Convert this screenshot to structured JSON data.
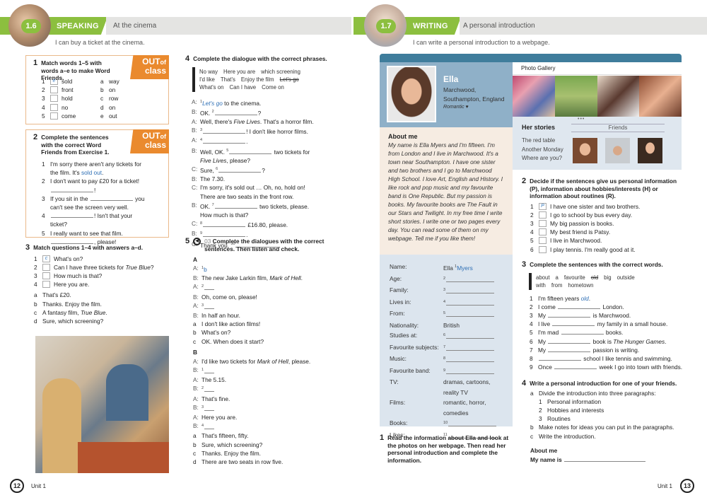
{
  "left": {
    "header": {
      "num": "1.6",
      "kind": "SPEAKING",
      "title": "At the cinema",
      "subtitle": "I can buy a ticket at the cinema."
    },
    "out_of_class": {
      "big": "OUT",
      "small": "of",
      "line2": "class"
    },
    "ex1": {
      "num": "1",
      "title": "Match words 1–5 with words a–e to make Word Friends.",
      "items": [
        {
          "n": "1",
          "box": "e",
          "s": [
            "sold"
          ]
        },
        {
          "n": "2",
          "box": "",
          "s": [
            "front"
          ]
        },
        {
          "n": "3",
          "box": "",
          "s": [
            "hold"
          ]
        },
        {
          "n": "4",
          "box": "",
          "s": [
            "no"
          ]
        },
        {
          "n": "5",
          "box": "",
          "s": [
            "come"
          ]
        }
      ],
      "matches": [
        {
          "n": "a",
          "s": [
            "way"
          ]
        },
        {
          "n": "b",
          "s": [
            "on"
          ]
        },
        {
          "n": "c",
          "s": [
            "row"
          ]
        },
        {
          "n": "d",
          "s": [
            "on"
          ]
        },
        {
          "n": "e",
          "s": [
            "out"
          ]
        }
      ]
    },
    "ex2": {
      "num": "2",
      "title": "Complete the sentences with the correct Word Friends from Exercise 1.",
      "items": [
        {
          "n": "1",
          "s": [
            "I'm sorry there aren't any tickets for the film. It's ",
            {
              "a": "sold out"
            },
            "."
          ]
        },
        {
          "n": "2",
          "s": [
            "I don't want to pay £20 for a ticket! ",
            {
              "br": 1
            },
            {
              "blank": 1
            },
            "!"
          ]
        },
        {
          "n": "3",
          "s": [
            "If you sit in the ",
            {
              "blank": 1
            },
            " you can't see the screen very well."
          ]
        },
        {
          "n": "4",
          "s": [
            {
              "blank": 1
            },
            "! Isn't that your ticket?"
          ]
        },
        {
          "n": "5",
          "s": [
            "I really want to see that film. ",
            {
              "br": 1
            },
            {
              "blank": 1
            },
            ", please!"
          ]
        }
      ]
    },
    "ex3": {
      "num": "3",
      "title": "Match questions 1–4 with answers a–d.",
      "items": [
        {
          "n": "1",
          "box": "c",
          "s": [
            "What's on?"
          ]
        },
        {
          "n": "2",
          "box": "",
          "s": [
            "Can I have three tickets for ",
            {
              "i": "True Blue"
            },
            "?"
          ]
        },
        {
          "n": "3",
          "box": "",
          "s": [
            "How much is that?"
          ]
        },
        {
          "n": "4",
          "box": "",
          "s": [
            "Here you are."
          ]
        }
      ],
      "answers": [
        {
          "n": "a",
          "s": [
            "That's £20."
          ]
        },
        {
          "n": "b",
          "s": [
            "Thanks. Enjoy the film."
          ]
        },
        {
          "n": "c",
          "s": [
            "A fantasy film, ",
            {
              "i": "True Blue"
            },
            "."
          ]
        },
        {
          "n": "d",
          "s": [
            "Sure, which screening?"
          ]
        }
      ]
    },
    "ex4": {
      "num": "4",
      "title": "Complete the dialogue with the correct phrases.",
      "words": [
        [
          "No way",
          "Here you are",
          "which screening"
        ],
        [
          "I'd like",
          "That's",
          "Enjoy the film",
          {
            "x": "Let's go"
          }
        ],
        [
          "What's on",
          "Can I have",
          "Come on"
        ]
      ],
      "lines": [
        {
          "sp": "A:",
          "s": [
            {
              "sup": "1"
            },
            {
              "ai": "Let's go"
            },
            " to the cinema."
          ]
        },
        {
          "sp": "B:",
          "s": [
            "OK. ",
            {
              "sup": "2"
            },
            {
              "blank": 1
            },
            "?"
          ]
        },
        {
          "sp": "A:",
          "s": [
            "Well, there's ",
            {
              "i": "Five Lives"
            },
            ". That's a horror film."
          ]
        },
        {
          "sp": "B:",
          "s": [
            {
              "sup": "3"
            },
            {
              "blank": 1
            },
            "! I don't like horror films."
          ]
        },
        {
          "sp": "A:",
          "s": [
            {
              "sup": "4"
            },
            {
              "blank": 1
            },
            "."
          ]
        },
        {
          "sp": "B:",
          "s": [
            "Well, OK. ",
            {
              "sup": "5"
            },
            {
              "blank": 1
            },
            " two tickets for ",
            {
              "br": 1
            },
            {
              "i": "Five Lives"
            },
            ", please?"
          ]
        },
        {
          "sp": "C:",
          "s": [
            "Sure, ",
            {
              "sup": "6"
            },
            {
              "blank": 1
            },
            "?"
          ]
        },
        {
          "sp": "B:",
          "s": [
            "The 7.30."
          ]
        },
        {
          "sp": "C:",
          "s": [
            "I'm sorry, it's sold out … Oh, no, hold on! There are two seats in the front row."
          ]
        },
        {
          "sp": "B:",
          "s": [
            "OK. ",
            {
              "sup": "7"
            },
            {
              "blank": 1
            },
            " two tickets, please. How much is that?"
          ]
        },
        {
          "sp": "C:",
          "s": [
            {
              "sup": "8"
            },
            {
              "blank": 1
            },
            " £16.80, please."
          ]
        },
        {
          "sp": "B:",
          "s": [
            {
              "sup": "9"
            },
            {
              "blank": 1
            },
            "."
          ]
        },
        {
          "sp": "C:",
          "s": [
            "Thank you. ",
            {
              "sup": "10"
            },
            {
              "blank": 1
            },
            "."
          ]
        }
      ]
    },
    "ex5": {
      "num": "5",
      "track": "03",
      "title": "Complete the dialogues with the correct sentences. Then listen and check.",
      "A": {
        "label": "A",
        "lines": [
          {
            "sp": "A:",
            "s": [
              {
                "sup": "1"
              },
              {
                "a": "b"
              }
            ]
          },
          {
            "sp": "B:",
            "s": [
              "The new Jake Larkin film, ",
              {
                "i": "Mark of Hell"
              },
              "."
            ]
          },
          {
            "sp": "A:",
            "s": [
              {
                "sup": "2"
              },
              {
                "blank": 1
              }
            ]
          },
          {
            "sp": "B:",
            "s": [
              "Oh, come on, please!"
            ]
          },
          {
            "sp": "A:",
            "s": [
              {
                "sup": "3"
              },
              {
                "blank": 1
              }
            ]
          },
          {
            "sp": "B:",
            "s": [
              "In half an hour."
            ]
          }
        ],
        "options": [
          {
            "n": "a",
            "s": [
              "I don't like action films!"
            ]
          },
          {
            "n": "b",
            "s": [
              "What's on?"
            ]
          },
          {
            "n": "c",
            "s": [
              "OK. When does it start?"
            ]
          }
        ]
      },
      "B": {
        "label": "B",
        "lines": [
          {
            "sp": "A:",
            "s": [
              "I'd like two tickets for ",
              {
                "i": "Mark of Hell"
              },
              ", please."
            ]
          },
          {
            "sp": "B:",
            "s": [
              {
                "sup": "1"
              },
              {
                "blank": 1
              }
            ]
          },
          {
            "sp": "A:",
            "s": [
              "The 5.15."
            ]
          },
          {
            "sp": "B:",
            "s": [
              {
                "sup": "2"
              },
              {
                "blank": 1
              }
            ]
          },
          {
            "sp": "A:",
            "s": [
              "That's fine."
            ]
          },
          {
            "sp": "B:",
            "s": [
              {
                "sup": "3"
              },
              {
                "blank": 1
              }
            ]
          },
          {
            "sp": "A:",
            "s": [
              "Here you are."
            ]
          },
          {
            "sp": "B:",
            "s": [
              {
                "sup": "4"
              },
              {
                "blank": 1
              }
            ]
          }
        ],
        "options": [
          {
            "n": "a",
            "s": [
              "That's fifteen, fifty."
            ]
          },
          {
            "n": "b",
            "s": [
              "Sure, which screening?"
            ]
          },
          {
            "n": "c",
            "s": [
              "Thanks. Enjoy the film."
            ]
          },
          {
            "n": "d",
            "s": [
              "There are two seats in row five."
            ]
          }
        ]
      }
    },
    "footer": {
      "page": "12",
      "unit": "Unit 1"
    }
  },
  "right": {
    "header": {
      "num": "1.7",
      "kind": "WRITING",
      "title": "A personal introduction",
      "subtitle": "I can write a personal introduction to a webpage."
    },
    "profile": {
      "name": "Ella",
      "location1": "Marchwood,",
      "location2": "Southampton, England",
      "status": "Romantic ♥"
    },
    "gallery": {
      "title": "Photo Gallery",
      "dots": "•••"
    },
    "stories": {
      "title": "Her stories",
      "items": [
        "The red table",
        "Another Monday",
        "Where are you?"
      ]
    },
    "friends": {
      "title": "Friends"
    },
    "about": {
      "title": "About me",
      "text": [
        {
          "i": "My name is Ella Myers and I'm fifteen. I'm from London and I live in Marchwood. It's a town near Southampton. I have one sister and two brothers and I go to Marchwood High School. I love Art, English and History. I like rock and pop music and my favourite band is "
        },
        {
          "it": "One Republic"
        },
        {
          "i": ". But my passion is books. My favourite books are "
        },
        {
          "it": "The Fault in our Stars"
        },
        {
          "i": " and "
        },
        {
          "it": "Twilight"
        },
        {
          "i": ". In my free time I write short stories. I write one or two pages every day. You can read some of them on my webpage. Tell me if you like them!"
        }
      ]
    },
    "info": [
      {
        "l": "Name:",
        "s": [
          "Ella ",
          {
            "sup": "1"
          },
          {
            "a": "Myers"
          }
        ]
      },
      {
        "l": "Age:",
        "s": [
          {
            "sup": "2"
          },
          {
            "blank": 1
          }
        ]
      },
      {
        "l": "Family:",
        "s": [
          {
            "sup": "3"
          },
          {
            "blank": 1
          }
        ]
      },
      {
        "l": "Lives in:",
        "s": [
          {
            "sup": "4"
          },
          {
            "blank": 1
          }
        ]
      },
      {
        "l": "From:",
        "s": [
          {
            "sup": "5"
          },
          {
            "blank": 1
          }
        ]
      },
      {
        "l": "Nationality:",
        "s": [
          "British"
        ]
      },
      {
        "l": "Studies at:",
        "s": [
          {
            "sup": "6"
          },
          {
            "blank": 1
          }
        ]
      },
      {
        "l": "Favourite subjects:",
        "s": [
          {
            "sup": "7"
          },
          {
            "blank": 1
          }
        ]
      },
      {
        "l": "Music:",
        "s": [
          {
            "sup": "8"
          },
          {
            "blank": 1
          }
        ]
      },
      {
        "l": "Favourite band:",
        "s": [
          {
            "sup": "9"
          },
          {
            "blank": 1
          }
        ]
      },
      {
        "l": "TV:",
        "s": [
          "dramas, cartoons, reality TV"
        ]
      },
      {
        "l": "Films:",
        "s": [
          "romantic, horror, comedies"
        ]
      },
      {
        "l": "Books:",
        "s": [
          {
            "sup": "10"
          },
          {
            "blank": 1
          }
        ]
      },
      {
        "l": "Likes:",
        "s": [
          {
            "sup": "11"
          },
          {
            "blank": 1
          }
        ]
      }
    ],
    "ex1": {
      "num": "1",
      "title": "Read the information about Ella and look at the photos on her webpage. Then read her personal introduction and complete the information."
    },
    "ex2": {
      "num": "2",
      "title": "Decide if the sentences give us personal information (P), information about hobbies/interests (H) or information about routines (R).",
      "items": [
        {
          "n": "1",
          "box": "P",
          "s": [
            "I have one sister and two brothers."
          ]
        },
        {
          "n": "2",
          "box": "",
          "s": [
            "I go to school by bus every day."
          ]
        },
        {
          "n": "3",
          "box": "",
          "s": [
            "My big passion is books."
          ]
        },
        {
          "n": "4",
          "box": "",
          "s": [
            "My best friend is Patsy."
          ]
        },
        {
          "n": "5",
          "box": "",
          "s": [
            "I live in Marchwood."
          ]
        },
        {
          "n": "6",
          "box": "",
          "s": [
            "I play tennis. I'm really good at it."
          ]
        }
      ]
    },
    "ex3": {
      "num": "3",
      "title": "Complete the sentences with the correct words.",
      "words": [
        [
          "about",
          "a",
          "favourite",
          {
            "x": "old"
          },
          "big",
          "outside"
        ],
        [
          "with",
          "from",
          "hometown"
        ]
      ],
      "items": [
        {
          "n": "1",
          "s": [
            "I'm fifteen years ",
            {
              "ai": "old"
            },
            "."
          ]
        },
        {
          "n": "2",
          "s": [
            "I come ",
            {
              "blank": 1
            },
            " London."
          ]
        },
        {
          "n": "3",
          "s": [
            "My ",
            {
              "blank": 1
            },
            " is Marchwood."
          ]
        },
        {
          "n": "4",
          "s": [
            "I live ",
            {
              "blank": 1
            },
            " my family in a small house."
          ]
        },
        {
          "n": "5",
          "s": [
            "I'm mad ",
            {
              "blank": 1
            },
            " books."
          ]
        },
        {
          "n": "6",
          "s": [
            "My ",
            {
              "blank": 1
            },
            " book is ",
            {
              "i": "The Hunger Games"
            },
            "."
          ]
        },
        {
          "n": "7",
          "s": [
            "My ",
            {
              "blank": 1
            },
            " passion is writing."
          ]
        },
        {
          "n": "8",
          "s": [
            {
              "blank": 1
            },
            " school I like tennis and swimming."
          ]
        },
        {
          "n": "9",
          "s": [
            "Once ",
            {
              "blank": 1
            },
            " week I go into town with friends."
          ]
        }
      ]
    },
    "ex4": {
      "num": "4",
      "title": "Write a personal introduction for one of your friends.",
      "steps": [
        {
          "n": "a",
          "s": [
            "Divide the introduction into three paragraphs:"
          ]
        }
      ],
      "paras": [
        {
          "n": "1",
          "s": [
            "Personal information"
          ]
        },
        {
          "n": "2",
          "s": [
            "Hobbies and interests"
          ]
        },
        {
          "n": "3",
          "s": [
            "Routines"
          ]
        }
      ],
      "steps2": [
        {
          "n": "b",
          "s": [
            "Make notes for ideas you can put in the paragraphs."
          ]
        },
        {
          "n": "c",
          "s": [
            "Write the introduction."
          ]
        }
      ],
      "about_title": "About me",
      "my_name": "My name is"
    },
    "footer": {
      "page": "13",
      "unit": "Unit 1"
    }
  },
  "colors": {
    "green": "#8cbf3f",
    "orange": "#ea8a2e",
    "web_blue": "#3f7d9c",
    "profile_blue": "#8fb0c8",
    "cream": "#f6ece2",
    "info_blue": "#dce5ee",
    "answer": "#2e6fb5"
  }
}
